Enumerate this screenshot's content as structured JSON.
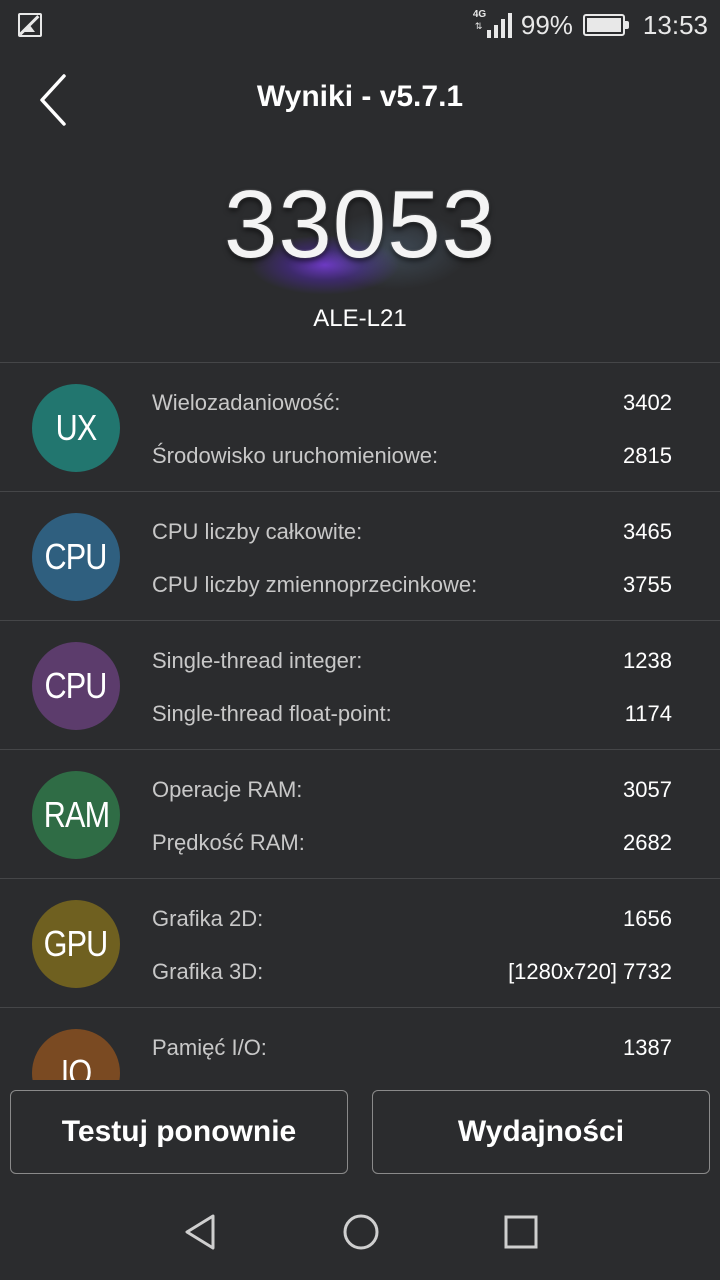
{
  "status_bar": {
    "network": "4G",
    "battery_percent": "99%",
    "time": "13:53"
  },
  "header": {
    "title": "Wyniki - v5.7.1"
  },
  "score": {
    "value": "33053",
    "device": "ALE-L21"
  },
  "results": [
    {
      "badge": "UX",
      "color": "#22766f",
      "items": [
        {
          "label": "Wielozadaniowość:",
          "value": "3402"
        },
        {
          "label": "Środowisko uruchomieniowe:",
          "value": "2815"
        }
      ]
    },
    {
      "badge": "CPU",
      "color": "#2f5f7f",
      "items": [
        {
          "label": "CPU liczby całkowite:",
          "value": "3465"
        },
        {
          "label": "CPU liczby zmiennoprzecinkowe:",
          "value": "3755"
        }
      ]
    },
    {
      "badge": "CPU",
      "color": "#5c3c6c",
      "items": [
        {
          "label": "Single-thread integer:",
          "value": "1238"
        },
        {
          "label": "Single-thread float-point:",
          "value": "1174"
        }
      ]
    },
    {
      "badge": "RAM",
      "color": "#2f6c45",
      "items": [
        {
          "label": "Operacje RAM:",
          "value": "3057"
        },
        {
          "label": "Prędkość RAM:",
          "value": "2682"
        }
      ]
    },
    {
      "badge": "GPU",
      "color": "#6f6020",
      "items": [
        {
          "label": "Grafika 2D:",
          "value": "1656"
        },
        {
          "label": "Grafika 3D:",
          "value": "[1280x720] 7732"
        }
      ]
    },
    {
      "badge": "IO",
      "color": "#7a4a22",
      "items": [
        {
          "label": "Pamięć I/O:",
          "value": "1387"
        }
      ]
    }
  ],
  "buttons": {
    "retest": "Testuj ponownie",
    "performance": "Wydajności"
  },
  "icons": {
    "gallery": "image-icon",
    "back": "chevron-left-icon",
    "nav_back": "triangle-back-icon",
    "nav_home": "circle-home-icon",
    "nav_recent": "square-recent-icon"
  }
}
